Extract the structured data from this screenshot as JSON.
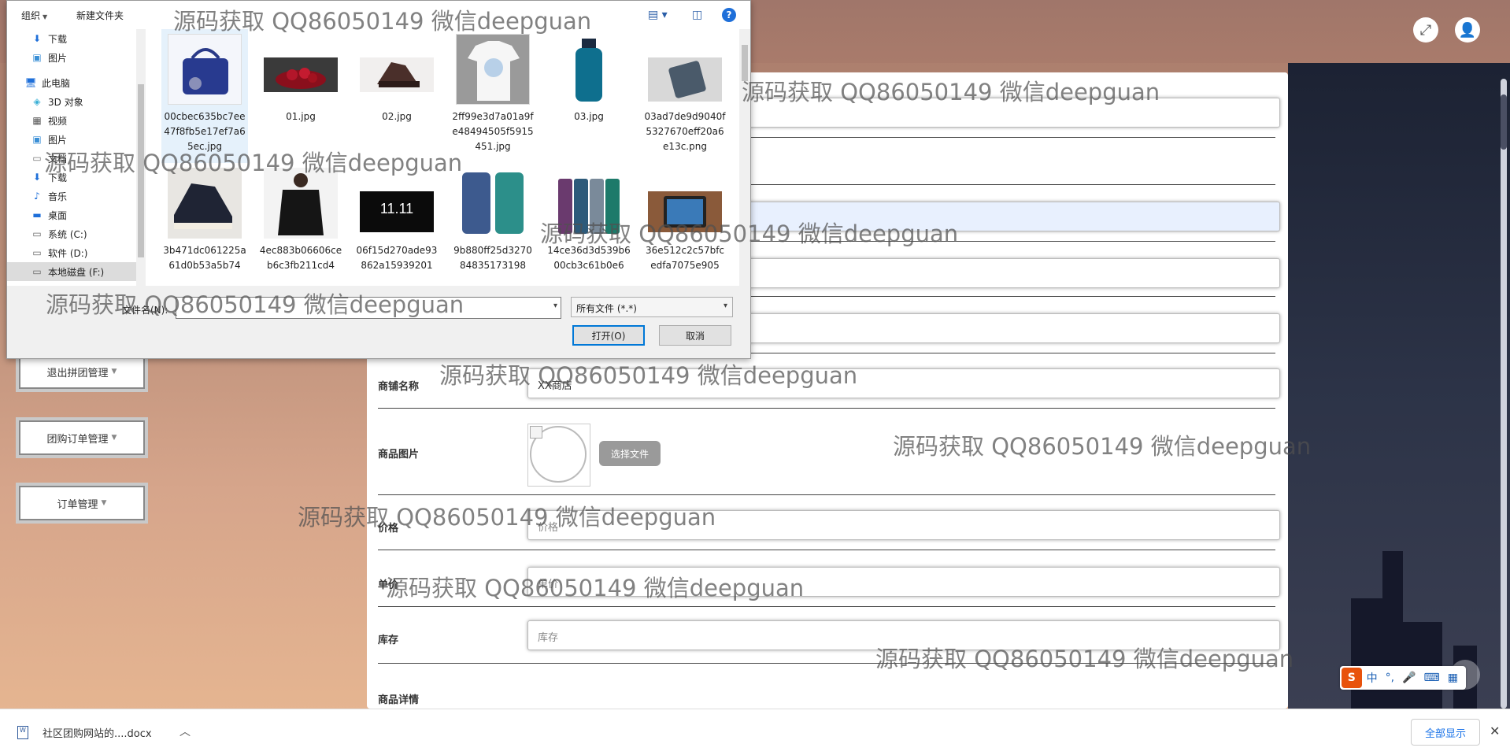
{
  "dialog": {
    "toolbar": {
      "organize": "组织",
      "new_folder": "新建文件夹"
    },
    "tree": [
      {
        "icon": "download-icon",
        "label": "下载",
        "pinned": true
      },
      {
        "icon": "pictures-icon",
        "label": "图片",
        "pinned": true
      },
      {
        "icon": "computer-icon",
        "label": "此电脑"
      },
      {
        "icon": "3d-objects-icon",
        "label": "3D 对象"
      },
      {
        "icon": "videos-icon",
        "label": "视频"
      },
      {
        "icon": "pictures-icon",
        "label": "图片"
      },
      {
        "icon": "documents-icon",
        "label": "文档"
      },
      {
        "icon": "download-icon",
        "label": "下载"
      },
      {
        "icon": "music-icon",
        "label": "音乐"
      },
      {
        "icon": "desktop-icon",
        "label": "桌面"
      },
      {
        "icon": "drive-icon",
        "label": "系统 (C:)"
      },
      {
        "icon": "drive-icon",
        "label": "软件 (D:)"
      },
      {
        "icon": "drive-icon",
        "label": "本地磁盘 (F:)",
        "selected": true
      }
    ],
    "files": [
      {
        "name": "00cbec635bc7ee47f8fb5e17ef7a65ec.jpg",
        "thumb": "handbag"
      },
      {
        "name": "01.jpg",
        "thumb": "cherries"
      },
      {
        "name": "02.jpg",
        "thumb": "massage-chair"
      },
      {
        "name": "2ff99e3d7a01a9fe48494505f5915451.jpg",
        "thumb": "tshirt"
      },
      {
        "name": "03.jpg",
        "thumb": "shampoo"
      },
      {
        "name": "03ad7de9d9040f5327670eff20a6e13c.png",
        "thumb": "phone"
      },
      {
        "name": "3b471dc061225a61d0b53a5b74",
        "thumb": "sneakers"
      },
      {
        "name": "4ec883b06606ceb6c3fb211cd4",
        "thumb": "black-tshirt"
      },
      {
        "name": "06f15d270ade93862a15939201",
        "thumb": "sale-banner"
      },
      {
        "name": "9b880ff25d327084835173198",
        "thumb": "phone-case"
      },
      {
        "name": "14ce36d3d539b600cb3c61b0e6",
        "thumb": "phones"
      },
      {
        "name": "36e512c2c57bfcedfa7075e905",
        "thumb": "tablet"
      }
    ],
    "filename_label": "文件名(N):",
    "filename_value": "",
    "filetype": "所有文件 (*.*)",
    "open_button": "打开(O)",
    "cancel_button": "取消"
  },
  "sidebar": {
    "items": [
      {
        "label": "退出拼团管理"
      },
      {
        "label": "团购订单管理"
      },
      {
        "label": "订单管理"
      }
    ]
  },
  "form": {
    "shop_label": "商铺名称",
    "shop_value": "XX商店",
    "image_label": "商品图片",
    "choose_file": "选择文件",
    "price_label": "价格",
    "price_placeholder": "价格",
    "unit_label": "单价",
    "unit_placeholder": "单价",
    "stock_label": "库存",
    "stock_placeholder": "库存",
    "detail_label": "商品详情"
  },
  "download_bar": {
    "file": "社区团购网站的....docx",
    "show_all": "全部显示"
  },
  "ime": {
    "lang": "中"
  },
  "watermark": "源码获取 QQ86050149 微信deepguan"
}
